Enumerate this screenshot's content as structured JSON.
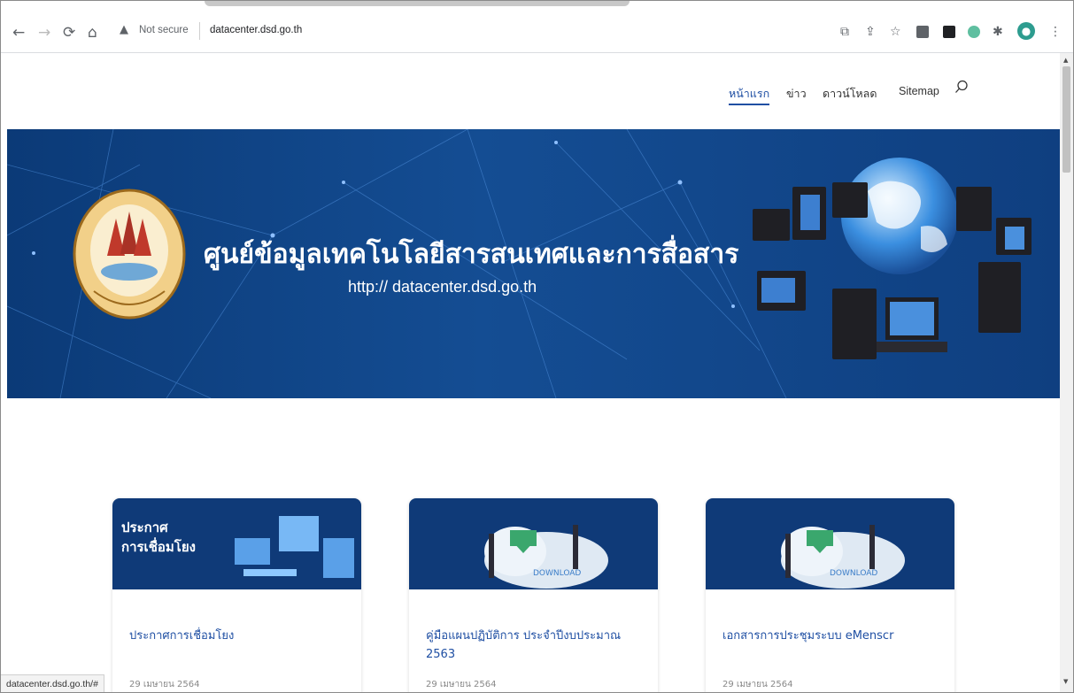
{
  "browser": {
    "security_label": "Not secure",
    "url": "datacenter.dsd.go.th",
    "status_url": "datacenter.dsd.go.th/#"
  },
  "nav": {
    "items": [
      {
        "label": "หน้าแรก",
        "active": true
      },
      {
        "label": "ข่าว"
      },
      {
        "label": "ดาวน์โหลด"
      },
      {
        "label": "Sitemap"
      }
    ]
  },
  "hero": {
    "title": "ศูนย์ข้อมูลเทคโนโลยีสารสนเทศและการสื่อสาร",
    "url": "http:// datacenter.dsd.go.th"
  },
  "cards": [
    {
      "image_text_line1": "ประกาศ",
      "image_text_line2": "การเชื่อมโยง",
      "title": "ประกาศการเชื่อมโยง",
      "date": "29 เมษายน 2564"
    },
    {
      "image_badge": "DOWNLOAD",
      "title": "คู่มือแผนปฏิบัติการ ประจำปีงบประมาณ 2563",
      "date": "29 เมษายน 2564"
    },
    {
      "image_badge": "DOWNLOAD",
      "title": "เอกสารการประชุมระบบ eMenscr",
      "date": "29 เมษายน 2564"
    }
  ],
  "colors": {
    "brand_blue": "#1f4fa3",
    "hero_blue": "#0f3f80"
  }
}
